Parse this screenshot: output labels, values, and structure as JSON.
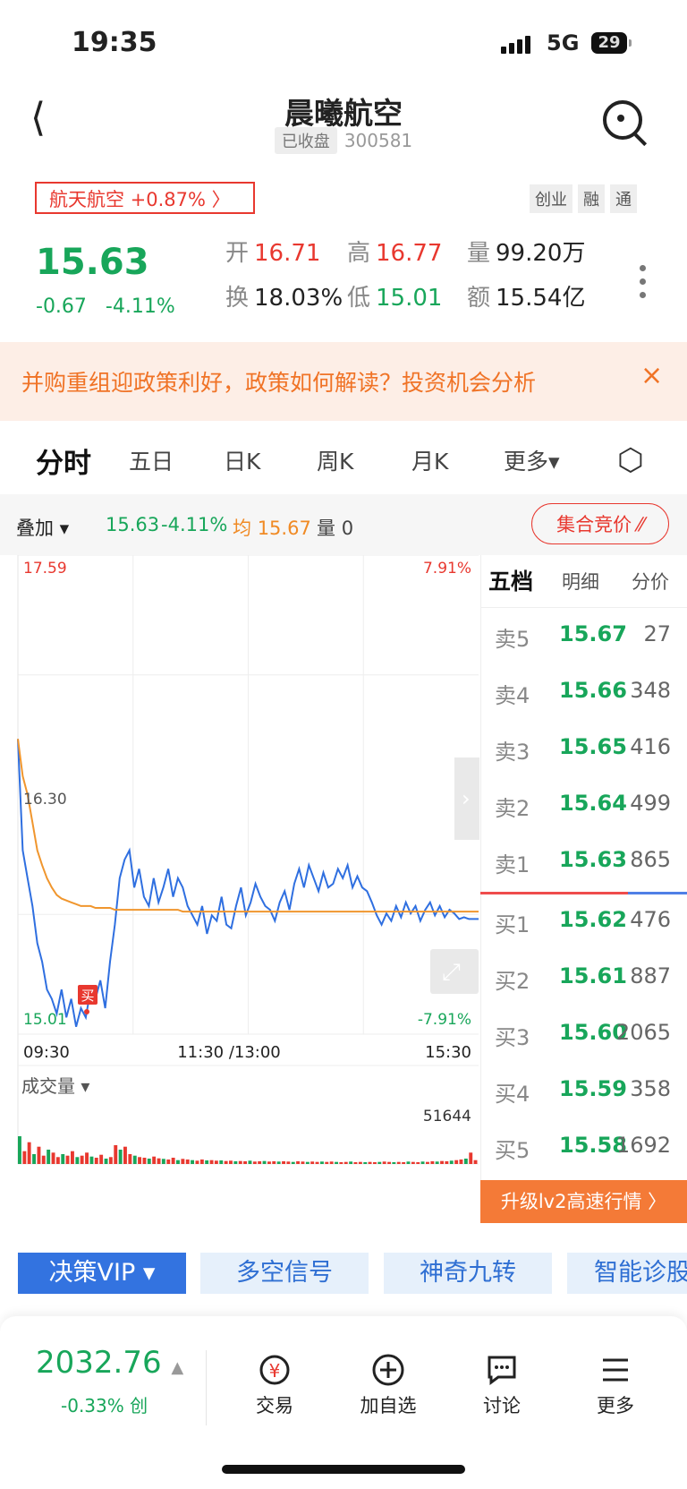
{
  "status_bar": {
    "time": "19:35",
    "network": "5G",
    "battery": "29"
  },
  "header": {
    "title": "晨曦航空",
    "status_badge": "已收盘",
    "code": "300581"
  },
  "sector": {
    "label": "航天航空 +0.87% 〉"
  },
  "tags": [
    "创业",
    "融",
    "通"
  ],
  "quote": {
    "price": "15.63",
    "change": "-0.67",
    "change_pct": "-4.11%",
    "open_label": "开",
    "open": "16.71",
    "high_label": "高",
    "high": "16.77",
    "volume_label": "量",
    "volume": "99.20万",
    "turnover_label": "换",
    "turnover": "18.03%",
    "low_label": "低",
    "low": "15.01",
    "amount_label": "额",
    "amount": "15.54亿"
  },
  "banner": {
    "text": "并购重组迎政策利好，政策如何解读？投资机会分析",
    "close": "×"
  },
  "tabs": [
    "分时",
    "五日",
    "日K",
    "周K",
    "月K",
    "更多▾"
  ],
  "overlay": {
    "label": "叠加 ▾",
    "price": "15.63",
    "pct": "-4.11%",
    "avg_label": "均",
    "avg": "15.67",
    "vol_label": "量",
    "vol": "0",
    "auction": "集合竞价 ⁄⁄"
  },
  "chart_data": {
    "type": "line",
    "title": "",
    "x_labels": [
      "09:30",
      "11:30 /13:00",
      "15:30"
    ],
    "y_top_price": "17.59",
    "y_mid_price": "16.30",
    "y_bottom_price": "15.01",
    "y_top_pct": "7.91%",
    "y_bottom_pct": "-7.91%",
    "ylim": [
      15.01,
      17.59
    ],
    "marker_label": "买",
    "series": [
      {
        "name": "price",
        "color": "#2f6fe0",
        "values": [
          16.6,
          16.0,
          15.85,
          15.7,
          15.5,
          15.4,
          15.25,
          15.2,
          15.12,
          15.25,
          15.1,
          15.2,
          15.05,
          15.15,
          15.1,
          15.25,
          15.2,
          15.3,
          15.15,
          15.4,
          15.6,
          15.85,
          15.95,
          16.0,
          15.8,
          15.9,
          15.75,
          15.7,
          15.85,
          15.72,
          15.8,
          15.9,
          15.75,
          15.85,
          15.8,
          15.7,
          15.65,
          15.6,
          15.7,
          15.55,
          15.65,
          15.62,
          15.75,
          15.6,
          15.58,
          15.7,
          15.8,
          15.65,
          15.72,
          15.82,
          15.75,
          15.7,
          15.68,
          15.62,
          15.72,
          15.78,
          15.68,
          15.82,
          15.9,
          15.8,
          15.92,
          15.85,
          15.78,
          15.88,
          15.8,
          15.82,
          15.9,
          15.85,
          15.92,
          15.8,
          15.86,
          15.8,
          15.78,
          15.72,
          15.65,
          15.6,
          15.66,
          15.62,
          15.7,
          15.64,
          15.72,
          15.66,
          15.7,
          15.62,
          15.68,
          15.72,
          15.65,
          15.7,
          15.64,
          15.68,
          15.66,
          15.63,
          15.64,
          15.63,
          15.63,
          15.63
        ]
      },
      {
        "name": "avg",
        "color": "#f0962e",
        "values": [
          16.6,
          16.4,
          16.3,
          16.15,
          16.0,
          15.92,
          15.85,
          15.8,
          15.76,
          15.74,
          15.73,
          15.72,
          15.71,
          15.7,
          15.7,
          15.7,
          15.69,
          15.69,
          15.69,
          15.69,
          15.68,
          15.68,
          15.68,
          15.68,
          15.68,
          15.68,
          15.68,
          15.68,
          15.68,
          15.68,
          15.68,
          15.68,
          15.68,
          15.68,
          15.67,
          15.67,
          15.67,
          15.67,
          15.67,
          15.67,
          15.67,
          15.67,
          15.67,
          15.67,
          15.67,
          15.67,
          15.67,
          15.67,
          15.67,
          15.67,
          15.67,
          15.67,
          15.67,
          15.67,
          15.67,
          15.67,
          15.67,
          15.67,
          15.67,
          15.67,
          15.67,
          15.67,
          15.67,
          15.67,
          15.67,
          15.67,
          15.67,
          15.67,
          15.67,
          15.67,
          15.67,
          15.67,
          15.67,
          15.67,
          15.67,
          15.67,
          15.67,
          15.67,
          15.67,
          15.67,
          15.67,
          15.67,
          15.67,
          15.67,
          15.67,
          15.67,
          15.67,
          15.67,
          15.67,
          15.67,
          15.67,
          15.67,
          15.67,
          15.67,
          15.67,
          15.67
        ]
      }
    ],
    "volume_label": "成交量 ▾",
    "volume_max": "51644",
    "volume_values": [
      90,
      40,
      70,
      30,
      55,
      25,
      45,
      35,
      20,
      30,
      25,
      40,
      20,
      25,
      35,
      22,
      18,
      28,
      15,
      20,
      60,
      45,
      55,
      30,
      25,
      20,
      18,
      15,
      22,
      16,
      14,
      12,
      18,
      10,
      14,
      12,
      10,
      8,
      12,
      9,
      10,
      8,
      9,
      7,
      8,
      6,
      7,
      6,
      8,
      5,
      6,
      7,
      5,
      6,
      5,
      6,
      5,
      4,
      6,
      5,
      4,
      5,
      4,
      5,
      4,
      5,
      4,
      3,
      4,
      5,
      3,
      4,
      3,
      4,
      3,
      4,
      5,
      4,
      3,
      4,
      3,
      5,
      4,
      3,
      5,
      4,
      6,
      5,
      7,
      6,
      8,
      10,
      12,
      15,
      35,
      10
    ]
  },
  "order_book": {
    "tabs": [
      "五档",
      "明细",
      "分价"
    ],
    "asks": [
      {
        "label": "卖5",
        "price": "15.67",
        "vol": "27"
      },
      {
        "label": "卖4",
        "price": "15.66",
        "vol": "348"
      },
      {
        "label": "卖3",
        "price": "15.65",
        "vol": "416"
      },
      {
        "label": "卖2",
        "price": "15.64",
        "vol": "499"
      },
      {
        "label": "卖1",
        "price": "15.63",
        "vol": "865"
      }
    ],
    "bids": [
      {
        "label": "买1",
        "price": "15.62",
        "vol": "476"
      },
      {
        "label": "买2",
        "price": "15.61",
        "vol": "887"
      },
      {
        "label": "买3",
        "price": "15.60",
        "vol": "2065"
      },
      {
        "label": "买4",
        "price": "15.59",
        "vol": "358"
      },
      {
        "label": "买5",
        "price": "15.58",
        "vol": "1692"
      }
    ],
    "upgrade": "升级lv2高速行情 〉"
  },
  "functions": [
    "决策VIP ▾",
    "多空信号",
    "神奇九转",
    "智能诊股"
  ],
  "bottom": {
    "index_value": "2032.76",
    "index_change": "-0.33%",
    "index_name": "创",
    "nav": [
      {
        "label": "交易",
        "icon": "trade-icon"
      },
      {
        "label": "加自选",
        "icon": "add-watchlist-icon"
      },
      {
        "label": "讨论",
        "icon": "discussion-icon"
      },
      {
        "label": "更多",
        "icon": "more-menu-icon"
      }
    ]
  }
}
